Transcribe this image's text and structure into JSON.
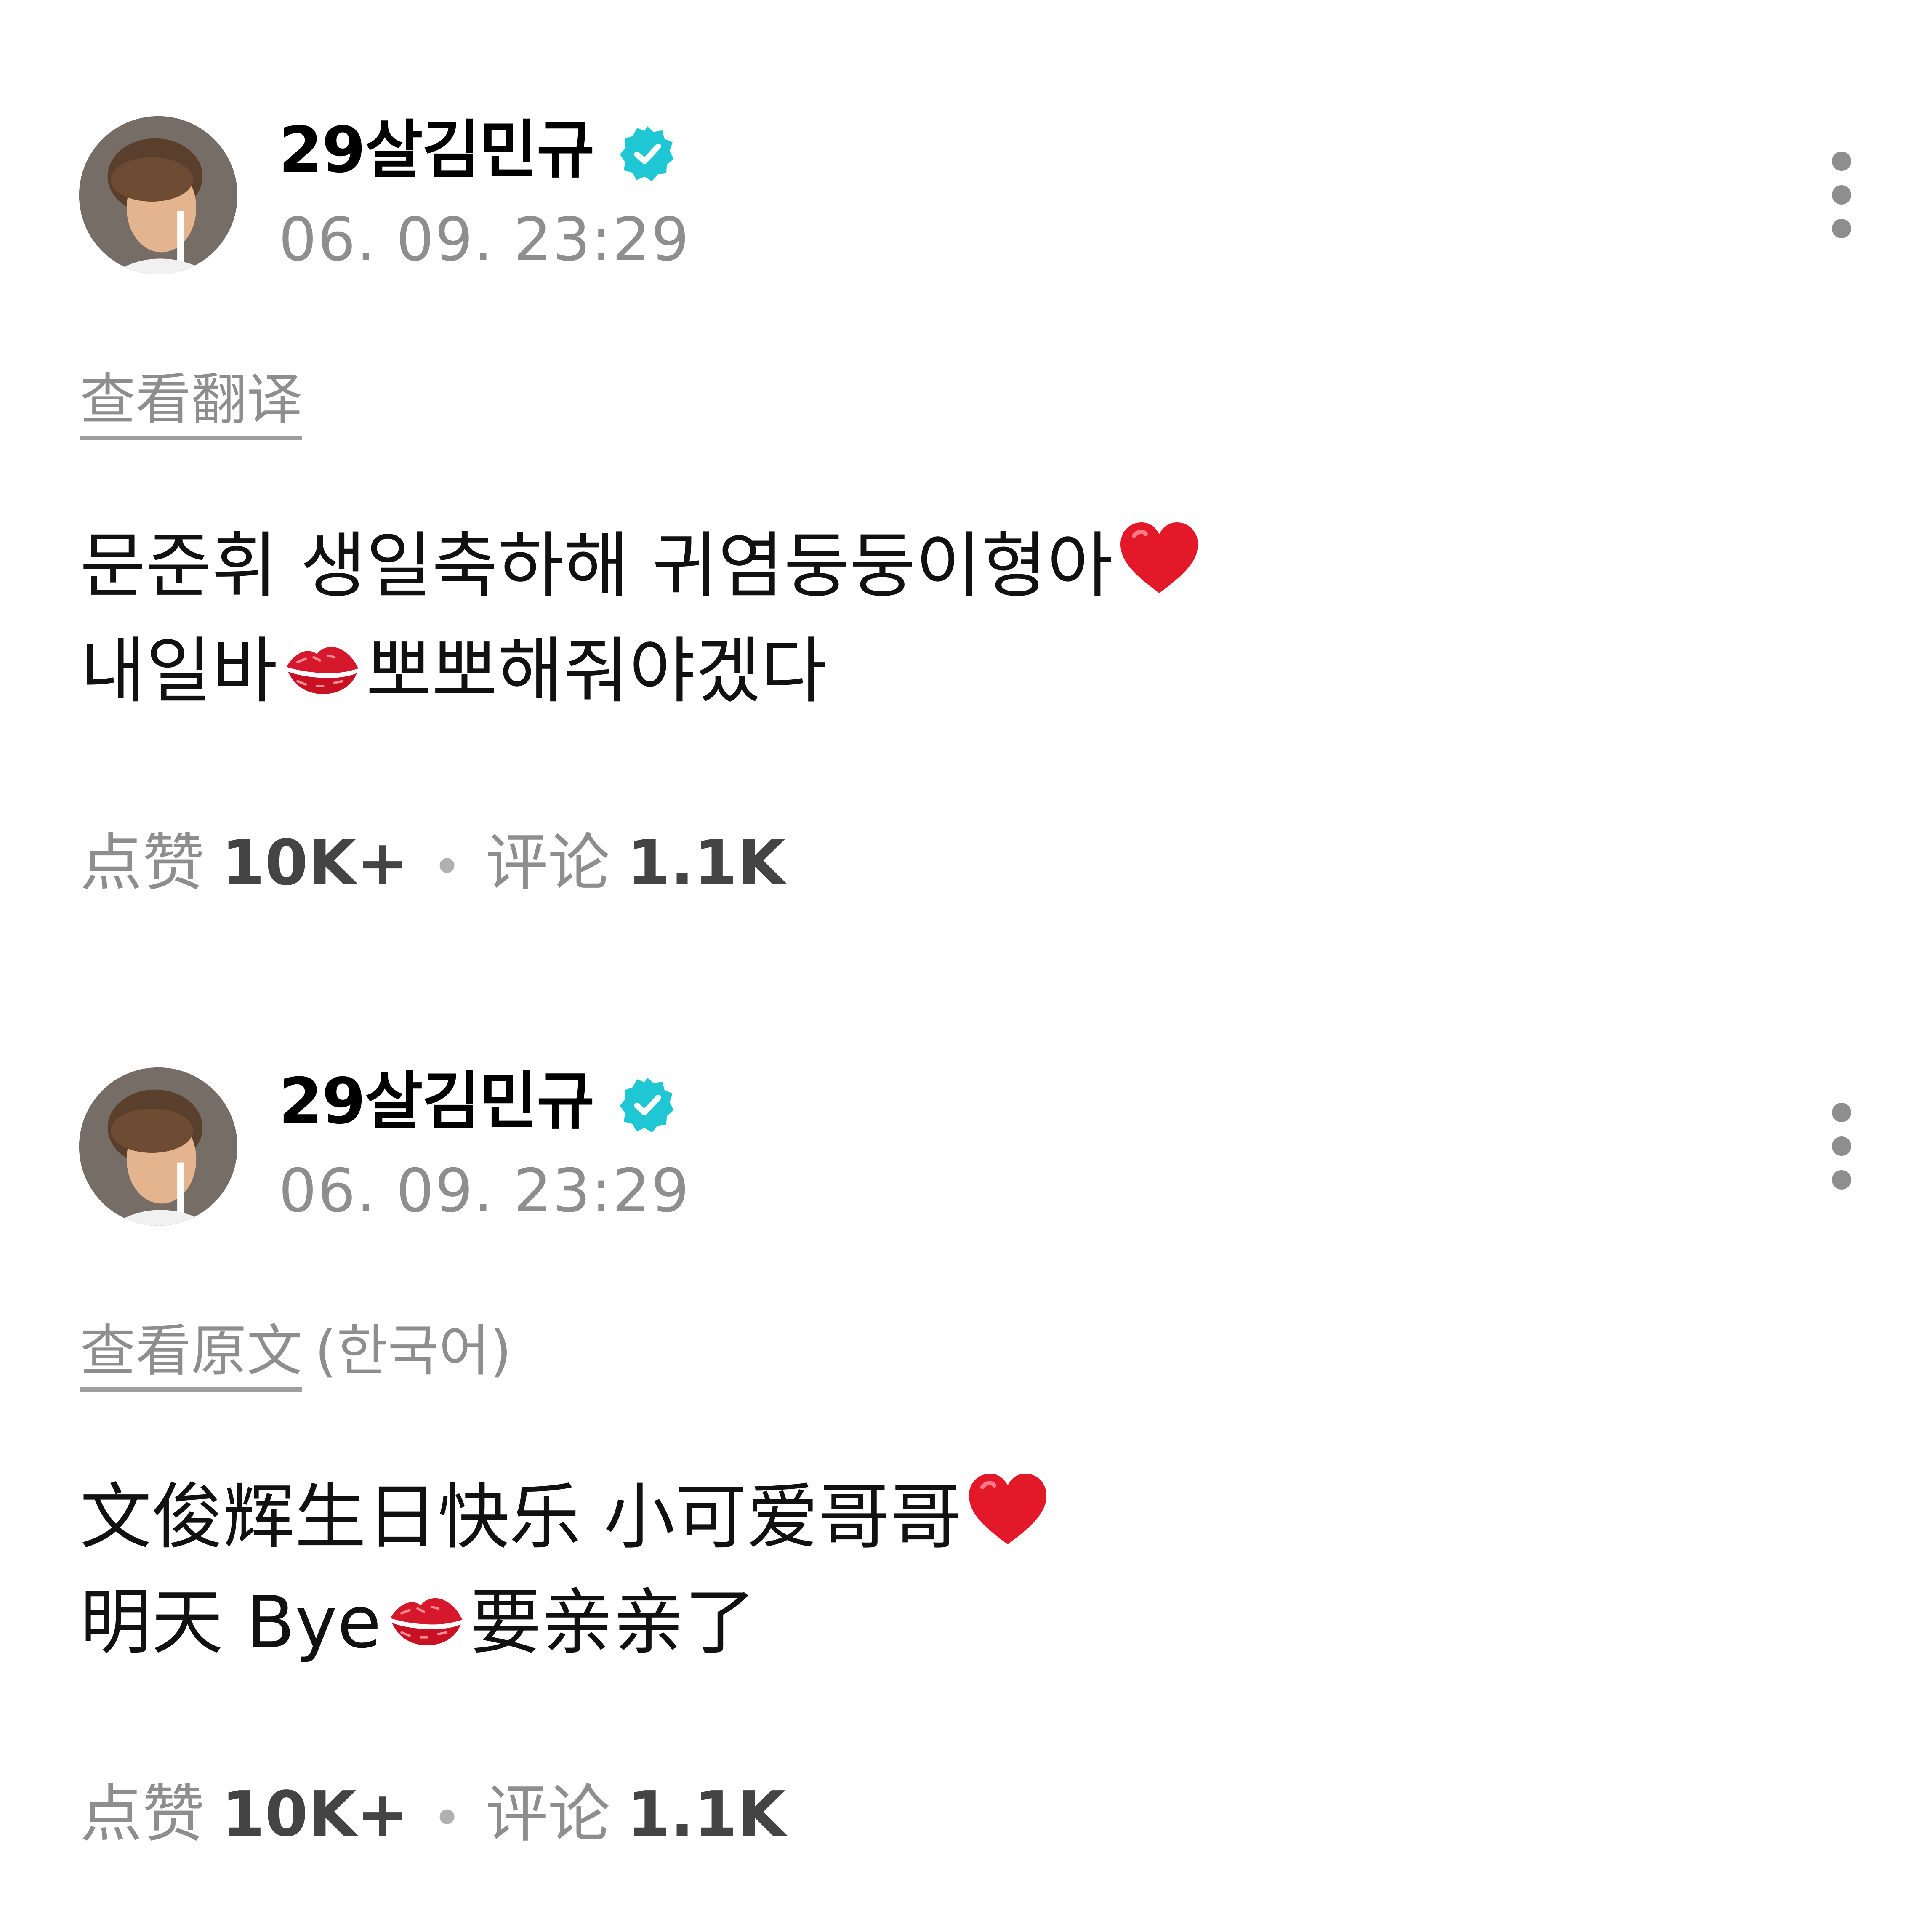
{
  "posts": [
    {
      "author": "29살김민규",
      "verified": true,
      "timestamp": "06. 09. 23:29",
      "translate_link": "查看翻译",
      "translate_lang": "",
      "lines": [
        {
          "before": "문준휘 생일축하해 귀염둥둥이형아",
          "emoji": "red-heart",
          "after": ""
        },
        {
          "before": "내일바",
          "emoji": "kiss-mark",
          "after": "뽀뽀해줘야겠다"
        }
      ],
      "likes_label": "点赞",
      "likes_value": "10K+",
      "comments_label": "评论",
      "comments_value": "1.1K"
    },
    {
      "author": "29살김민규",
      "verified": true,
      "timestamp": "06. 09. 23:29",
      "translate_link": "查看原文",
      "translate_lang": "(한국어)",
      "lines": [
        {
          "before": "文俊辉生日快乐 小可爱哥哥",
          "emoji": "red-heart",
          "after": ""
        },
        {
          "before": "明天 Bye",
          "emoji": "kiss-mark",
          "after": "要亲亲了"
        }
      ],
      "likes_label": "点赞",
      "likes_value": "10K+",
      "comments_label": "评论",
      "comments_value": "1.1K"
    }
  ],
  "colors": {
    "verified_badge": "#1fc7d4",
    "secondary_text": "#8e8e8e",
    "heart": "#e3192a",
    "kiss": "#d5182b"
  }
}
